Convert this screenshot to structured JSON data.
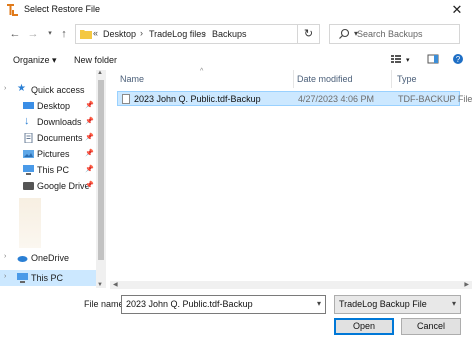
{
  "window": {
    "title": "Select Restore File",
    "app_icon": "tradelog-icon"
  },
  "nav": {
    "back_icon": "arrow-left-icon",
    "forward_icon": "arrow-right-icon",
    "recent_icon": "chevron-down-icon",
    "up_icon": "arrow-up-icon"
  },
  "address": {
    "overflow": "«",
    "crumbs": [
      "Desktop",
      "TradeLog files",
      "Backups"
    ],
    "separator": "›"
  },
  "search": {
    "placeholder": "Search Backups"
  },
  "toolbar": {
    "organize": "Organize ▾",
    "new_folder": "New folder"
  },
  "sidebar": {
    "items": [
      {
        "label": "Quick access",
        "icon": "star-icon",
        "pinned": false
      },
      {
        "label": "Desktop",
        "icon": "desktop-icon",
        "pinned": true
      },
      {
        "label": "Downloads",
        "icon": "download-icon",
        "pinned": true
      },
      {
        "label": "Documents",
        "icon": "documents-icon",
        "pinned": true
      },
      {
        "label": "Pictures",
        "icon": "pictures-icon",
        "pinned": true
      },
      {
        "label": "This PC",
        "icon": "computer-icon",
        "pinned": true
      },
      {
        "label": "Google Drive",
        "icon": "google-drive-icon",
        "pinned": true
      },
      {
        "label": "OneDrive",
        "icon": "cloud-icon",
        "pinned": false
      },
      {
        "label": "This PC",
        "icon": "computer-icon",
        "pinned": false
      }
    ],
    "pin_glyph": "📌"
  },
  "columns": {
    "name": "Name",
    "date_modified": "Date modified",
    "type": "Type"
  },
  "files": [
    {
      "name": "2023 John Q. Public.tdf-Backup",
      "date_modified": "4/27/2023 4:06 PM",
      "type": "TDF-BACKUP File",
      "selected": true
    }
  ],
  "footer": {
    "file_name_label": "File name:",
    "file_name_value": "2023 John Q. Public.tdf-Backup",
    "file_type_value": "TradeLog Backup File",
    "open_button": "Open",
    "cancel_button": "Cancel"
  },
  "colors": {
    "selection": "#cce8ff",
    "selection_border": "#99d1ff",
    "accent": "#0078d7"
  }
}
